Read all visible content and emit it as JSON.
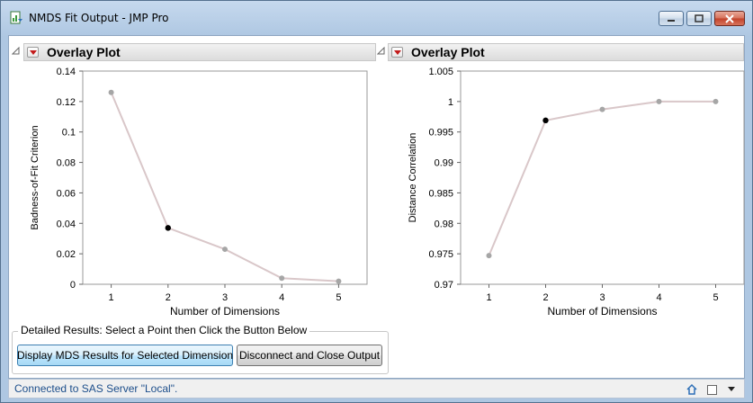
{
  "window": {
    "title": "NMDS Fit Output - JMP Pro",
    "icon": "jmp-report-icon"
  },
  "plots": [
    {
      "header": "Overlay Plot",
      "chart_data": {
        "type": "line",
        "xlabel": "Number of Dimensions",
        "ylabel": "Badness-of-Fit Criterion",
        "xlim": [
          0.5,
          5.5
        ],
        "ylim": [
          0,
          0.14
        ],
        "x_ticks": [
          "1",
          "2",
          "3",
          "4",
          "5"
        ],
        "y_ticks": [
          "0",
          "0.02",
          "0.04",
          "0.06",
          "0.08",
          "0.1",
          "0.12",
          "0.14"
        ],
        "y_tick_values": [
          0,
          0.02,
          0.04,
          0.06,
          0.08,
          0.1,
          0.12,
          0.14
        ],
        "x": [
          1,
          2,
          3,
          4,
          5
        ],
        "values": [
          0.126,
          0.037,
          0.023,
          0.004,
          0.002
        ],
        "selected_index": 1,
        "line_color": "#d9c7c9",
        "point_color": "#a6a6a6",
        "selected_color": "#000000"
      }
    },
    {
      "header": "Overlay Plot",
      "chart_data": {
        "type": "line",
        "xlabel": "Number of Dimensions",
        "ylabel": "Distance Correlation",
        "xlim": [
          0.5,
          5.5
        ],
        "ylim": [
          0.97,
          1.005
        ],
        "x_ticks": [
          "1",
          "2",
          "3",
          "4",
          "5"
        ],
        "y_ticks": [
          "0.97",
          "0.975",
          "0.98",
          "0.985",
          "0.99",
          "0.995",
          "1",
          "1.005"
        ],
        "y_tick_values": [
          0.97,
          0.975,
          0.98,
          0.985,
          0.99,
          0.995,
          1.0,
          1.005
        ],
        "x": [
          1,
          2,
          3,
          4,
          5
        ],
        "values": [
          0.9747,
          0.9969,
          0.9987,
          1.0,
          1.0
        ],
        "selected_index": 1,
        "line_color": "#d9c7c9",
        "point_color": "#a6a6a6",
        "selected_color": "#000000"
      }
    }
  ],
  "details": {
    "label": "Detailed Results: Select a Point then Click the Button Below",
    "display_button": "Display MDS Results for Selected Dimension",
    "disconnect_button": "Disconnect and Close Output"
  },
  "status": {
    "text": "Connected to SAS Server \"Local\"."
  }
}
